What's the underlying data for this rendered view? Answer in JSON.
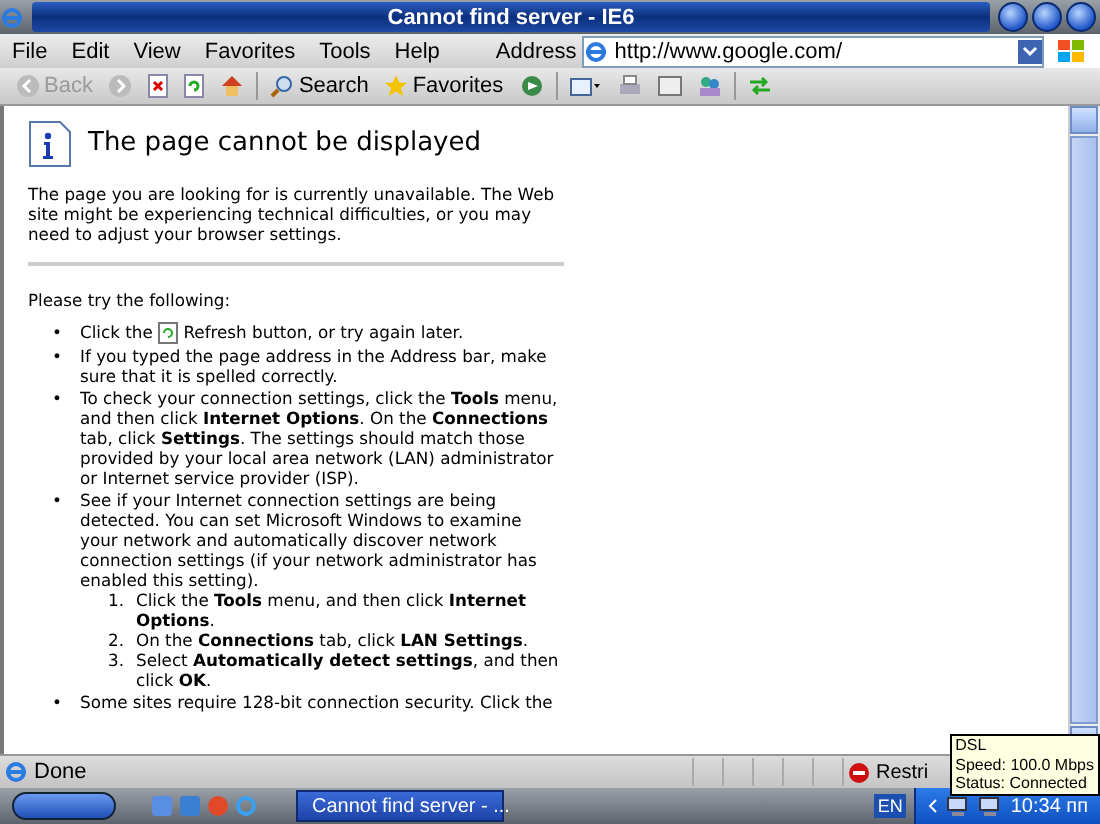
{
  "window": {
    "title": "Cannot find server - IE6"
  },
  "menu": [
    {
      "label": "File"
    },
    {
      "label": "Edit"
    },
    {
      "label": "View"
    },
    {
      "label": "Favorites"
    },
    {
      "label": "Tools"
    },
    {
      "label": "Help"
    }
  ],
  "address": {
    "label": "Address",
    "value": "http://www.google.com/"
  },
  "toolbar": {
    "back": {
      "label": "Back",
      "disabled": true
    },
    "forward": {
      "disabled": true
    },
    "search": "Search",
    "favorites": "Favorites"
  },
  "page": {
    "heading": "The page cannot be displayed",
    "intro": "The page you are looking for is currently unavailable. The Web site might be experiencing technical difficulties, or you may need to adjust your browser settings.",
    "try_heading": "Please try the following:",
    "bullets": [
      {
        "kind": "icon",
        "marker": "•",
        "lead": "Click the",
        "text": "Refresh button, or try again later."
      },
      {
        "kind": "text",
        "marker": "•",
        "text": "If you typed the page address in the Address bar, make sure that it is spelled correctly."
      },
      {
        "kind": "text",
        "marker": "•",
        "text": "To check your connection settings, click the **Tools** menu, and then click **Internet Options**. On the **Connections** tab, click **Settings**. The settings should match those provided by your local area network (LAN) administrator or Internet service provider (ISP)."
      },
      {
        "kind": "text",
        "marker": "•",
        "text": "See if your Internet connection settings are being detected. You can set Microsoft Windows to examine your network and automatically discover network connection settings (if your network administrator has enabled this setting).",
        "steps": [
          {
            "number": "1.",
            "text": "Click the **Tools** menu, and then click **Internet Options**."
          },
          {
            "number": "2.",
            "text": "On the **Connections** tab, click **LAN Settings**."
          },
          {
            "number": "3.",
            "text": "Select **Automatically detect settings**, and then click **OK**."
          }
        ]
      },
      {
        "kind": "text",
        "marker": "•",
        "text": "Some sites require 128-bit connection security. Click the"
      }
    ]
  },
  "status_bar": {
    "status": "Done",
    "zone": "Restri"
  },
  "tooltip": {
    "lines": [
      "DSL",
      "Speed: 100.0 Mbps",
      "Status: Connected"
    ]
  },
  "taskbar": {
    "task": "Cannot find server - ...",
    "language": "EN",
    "clock": "10:34 пп"
  }
}
